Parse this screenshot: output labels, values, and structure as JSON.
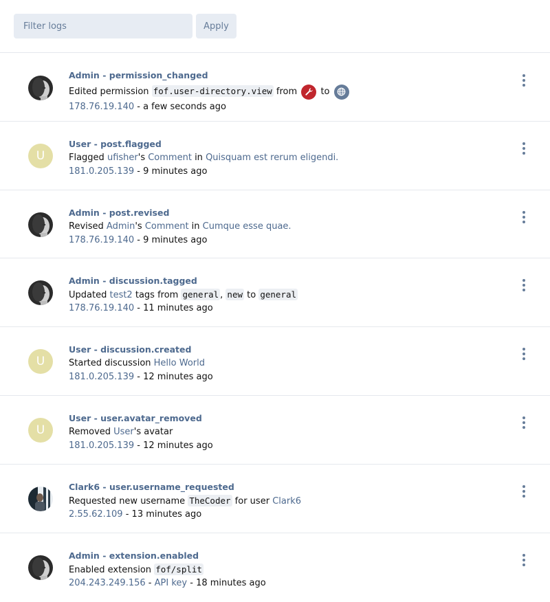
{
  "filter": {
    "placeholder": "Filter logs",
    "apply_label": "Apply"
  },
  "sep": " - ",
  "logs": [
    {
      "user": "Admin",
      "action": "permission_changed",
      "desc_prefix": "Edited permission ",
      "code": "fof.user-directory.view",
      "from_word": " from ",
      "to_word": " to ",
      "from_icon": "wrench-icon",
      "to_icon": "globe-icon",
      "ip": "178.76.19.140",
      "time": "a few seconds ago"
    },
    {
      "user": "User",
      "action": "post.flagged",
      "desc_prefix": "Flagged ",
      "link1": "ufisher",
      "mid1": "'s ",
      "link2": "Comment",
      "mid2": " in ",
      "link3": "Quisquam est rerum eligendi.",
      "ip": "181.0.205.139",
      "time": "9 minutes ago",
      "avatar_letter": "U"
    },
    {
      "user": "Admin",
      "action": "post.revised",
      "desc_prefix": "Revised ",
      "link1": "Admin",
      "mid1": "'s ",
      "link2": "Comment",
      "mid2": " in ",
      "link3": "Cumque esse quae.",
      "ip": "178.76.19.140",
      "time": "9 minutes ago"
    },
    {
      "user": "Admin",
      "action": "discussion.tagged",
      "desc_prefix": "Updated ",
      "link1": "test2",
      "mid1": " tags from ",
      "code1": "general",
      "comma": ", ",
      "code2": "new",
      "to_word": " to ",
      "code3": "general",
      "ip": "178.76.19.140",
      "time": "11 minutes ago"
    },
    {
      "user": "User",
      "action": "discussion.created",
      "desc_prefix": "Started discussion ",
      "link1": "Hello World",
      "ip": "181.0.205.139",
      "time": "12 minutes ago",
      "avatar_letter": "U"
    },
    {
      "user": "User",
      "action": "user.avatar_removed",
      "desc_prefix": "Removed ",
      "link1": "User",
      "mid1": "'s avatar",
      "ip": "181.0.205.139",
      "time": "12 minutes ago",
      "avatar_letter": "U"
    },
    {
      "user": "Clark6",
      "action": "user.username_requested",
      "desc_prefix": "Requested new username ",
      "code": "TheCoder",
      "mid1": " for user ",
      "link1": "Clark6",
      "ip": "2.55.62.109",
      "time": "13 minutes ago"
    },
    {
      "user": "Admin",
      "action": "extension.enabled",
      "desc_prefix": "Enabled extension ",
      "code": "fof/split",
      "ip": "204.243.249.156",
      "api": "API key",
      "time": "18 minutes ago"
    }
  ],
  "colors": {
    "link": "#4d698e",
    "wrench_bg": "#c0262d",
    "globe_bg": "#667c99",
    "letter_avatar_bg": "#e4dfa6"
  }
}
